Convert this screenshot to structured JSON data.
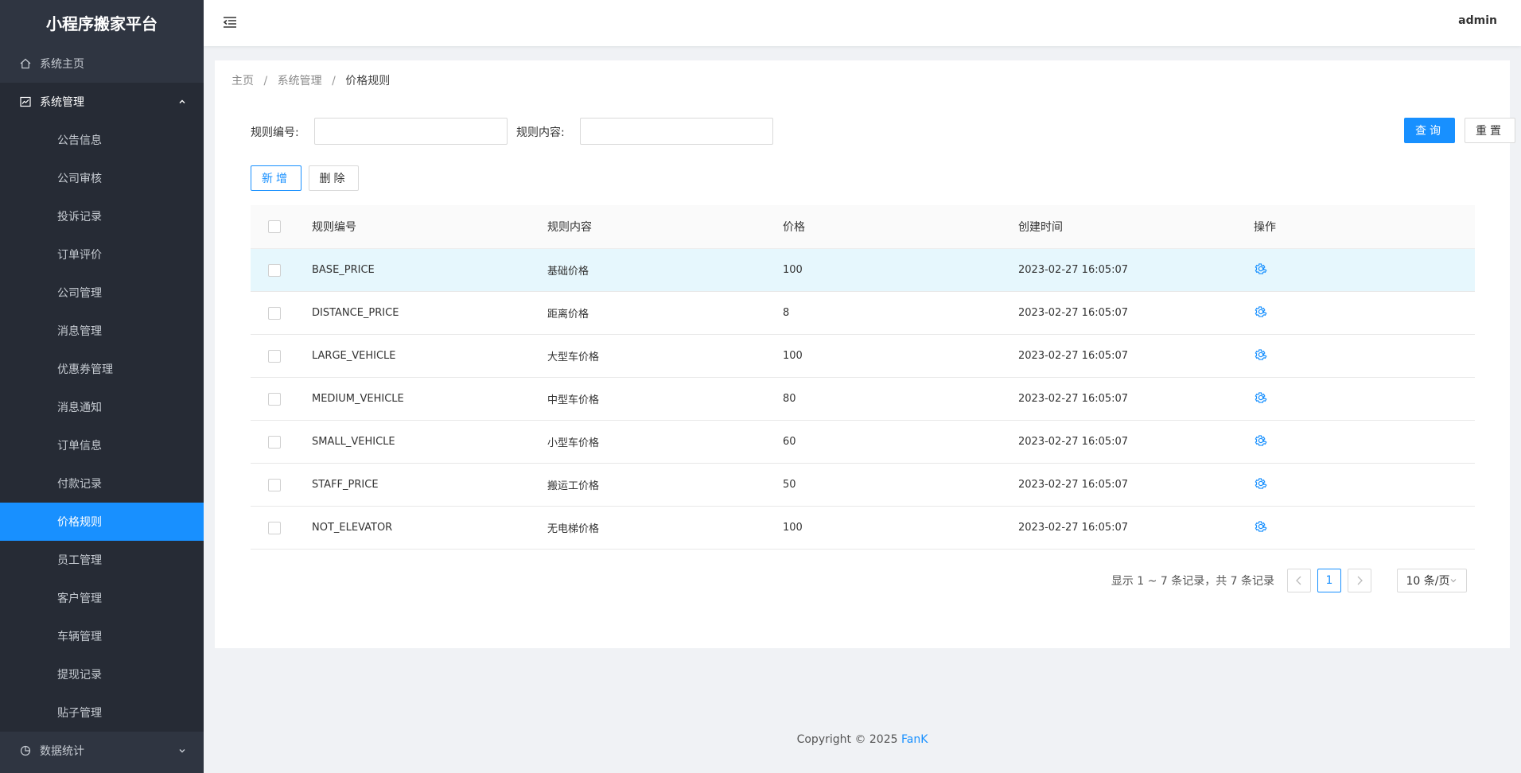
{
  "app": {
    "title": "小程序搬家平台"
  },
  "sidebar": {
    "home": "系统主页",
    "group": "系统管理",
    "items": [
      "公告信息",
      "公司审核",
      "投诉记录",
      "订单评价",
      "公司管理",
      "消息管理",
      "优惠券管理",
      "消息通知",
      "订单信息",
      "付款记录",
      "价格规则",
      "员工管理",
      "客户管理",
      "车辆管理",
      "提现记录",
      "贴子管理"
    ],
    "active": "价格规则",
    "stats": "数据统计"
  },
  "header": {
    "user": "admin"
  },
  "breadcrumb": {
    "home": "主页",
    "parent": "系统管理",
    "current": "价格规则",
    "sep": "/"
  },
  "search": {
    "rule_code_label": "规则编号:",
    "rule_content_label": "规则内容:",
    "rule_code_value": "",
    "rule_content_value": "",
    "query": "查询",
    "reset": "重置"
  },
  "actions": {
    "add": "新增",
    "delete": "删除"
  },
  "table": {
    "headers": [
      "规则编号",
      "规则内容",
      "价格",
      "创建时间",
      "操作"
    ],
    "rows": [
      {
        "code": "BASE_PRICE",
        "content": "基础价格",
        "price": "100",
        "created": "2023-02-27 16:05:07"
      },
      {
        "code": "DISTANCE_PRICE",
        "content": "距离价格",
        "price": "8",
        "created": "2023-02-27 16:05:07"
      },
      {
        "code": "LARGE_VEHICLE",
        "content": "大型车价格",
        "price": "100",
        "created": "2023-02-27 16:05:07"
      },
      {
        "code": "MEDIUM_VEHICLE",
        "content": "中型车价格",
        "price": "80",
        "created": "2023-02-27 16:05:07"
      },
      {
        "code": "SMALL_VEHICLE",
        "content": "小型车价格",
        "price": "60",
        "created": "2023-02-27 16:05:07"
      },
      {
        "code": "STAFF_PRICE",
        "content": "搬运工价格",
        "price": "50",
        "created": "2023-02-27 16:05:07"
      },
      {
        "code": "NOT_ELEVATOR",
        "content": "无电梯价格",
        "price": "100",
        "created": "2023-02-27 16:05:07"
      }
    ],
    "highlighted_row": 0,
    "operation_icon": "gear-icon"
  },
  "pagination": {
    "total_text": "显示 1 ~ 7 条记录，共 7 条记录",
    "current": "1",
    "page_size": "10 条/页"
  },
  "footer": {
    "text": "Copyright © 2025 ",
    "brand": "FanK"
  },
  "colors": {
    "sidebar_bg": "#2f3541",
    "primary": "#1890ff",
    "highlight_row": "#e6f7fd"
  }
}
